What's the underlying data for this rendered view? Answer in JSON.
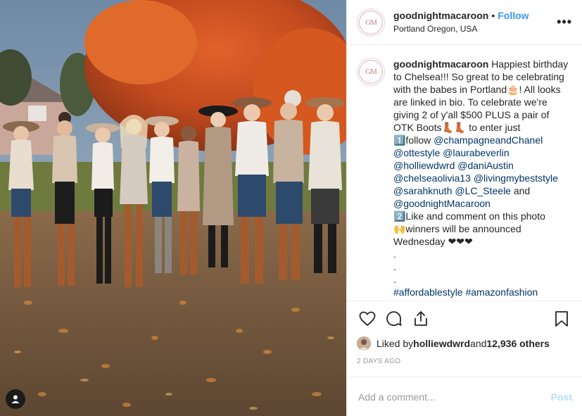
{
  "photo": {
    "alt_icon": "user-tag-icon"
  },
  "header": {
    "avatar_initials": "GM",
    "username": "goodnightmacaroon",
    "separator": "•",
    "follow_label": "Follow",
    "location": "Portland Oregon, USA",
    "more_icon": "more-options-icon",
    "more_label": "•••"
  },
  "caption": {
    "username": "goodnightmacaroon",
    "text": " Happiest birthday to Chelsea!!! So great to be celebrating with the babes in Portland🎂! All looks are linked in bio. To celebrate we're giving 2 of y'all $500 PLUS a pair of OTK Boots👢👢 to enter just\n1️⃣follow ",
    "mentions_1": "@champagneandChanel",
    "mentions_2": "@ottestyle",
    "mentions_3": "@laurabeverlin",
    "mentions_4": "@holliewdwrd",
    "mentions_5": "@daniAustin",
    "mentions_6": "@chelseaolivia13",
    "mentions_7": "@livingmybeststyle",
    "mentions_8": "@sarahknuth",
    "mentions_9": "@LC_Steele",
    "and": " and",
    "mentions_10": "@goodnightMacaroon",
    "step2": "2️⃣Like and comment on this photo",
    "winners": "🙌winners will be announced Wednesday ❤❤❤",
    "dots": ".\n.\n.",
    "hashtag_1": "#affordablestyle",
    "hashtag_2": "#amazonfashion"
  },
  "actions": {
    "like_icon": "heart-icon",
    "comment_icon": "comment-icon",
    "share_icon": "share-icon",
    "save_icon": "bookmark-icon"
  },
  "likes": {
    "prefix": "Liked by ",
    "user": "holliewdwrd",
    "middle": " and ",
    "count": "12,936 others"
  },
  "time": "2 DAYS AGO",
  "comment_box": {
    "placeholder": "Add a comment...",
    "post_label": "Post"
  }
}
